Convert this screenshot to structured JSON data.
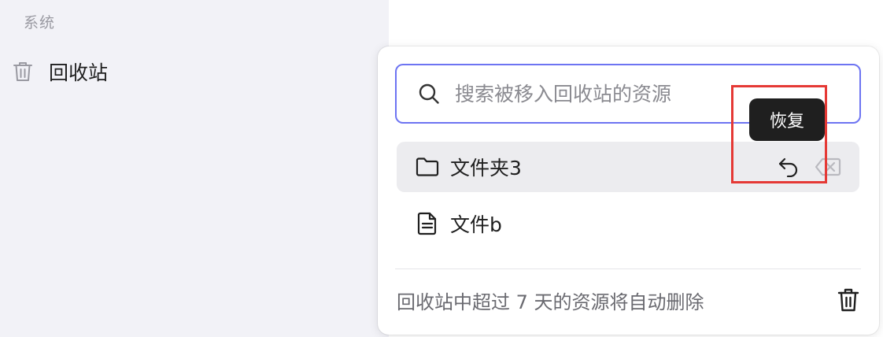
{
  "sidebar": {
    "section_title": "系统",
    "items": [
      {
        "label": "回收站",
        "icon": "trash-icon"
      }
    ]
  },
  "popover": {
    "search": {
      "placeholder": "搜索被移入回收站的资源",
      "value": ""
    },
    "items": [
      {
        "label": "文件夹3",
        "icon": "folder-icon",
        "hovered": true
      },
      {
        "label": "文件b",
        "icon": "document-icon",
        "hovered": false
      }
    ],
    "tooltip": "恢复",
    "footer_text": "回收站中超过 7 天的资源将自动删除"
  },
  "colors": {
    "sidebar_bg": "#f2f2f7",
    "search_border": "#6d74f2",
    "highlight_border": "#e53935",
    "tooltip_bg": "#1f1f1f"
  }
}
